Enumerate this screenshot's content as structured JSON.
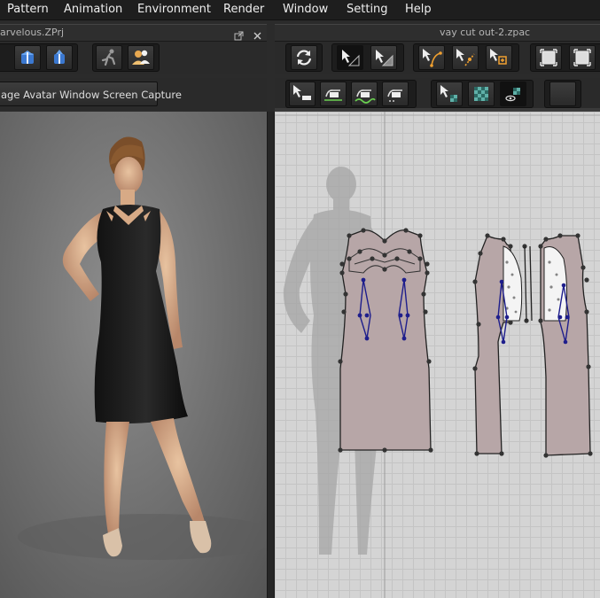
{
  "menu": {
    "items": [
      {
        "label": "Pattern"
      },
      {
        "label": "Animation"
      },
      {
        "label": "Environment"
      },
      {
        "label": "Render"
      },
      {
        "label": "Window"
      },
      {
        "label": "Setting"
      },
      {
        "label": "Help"
      }
    ]
  },
  "left_panel": {
    "title": "arvelous.ZPrj",
    "capture_button": "age Avatar Window Screen Capture"
  },
  "right_panel": {
    "title": "vay cut out-2.zpac"
  },
  "colors": {
    "pattern_fill": "#b7a6a7",
    "dart_line": "#1e1e8c",
    "accent_orange": "#f0a030"
  },
  "icons": {
    "left_toolbar": [
      "garment-view-icon",
      "garment-fold-icon",
      "running-avatar-icon",
      "avatar-users-icon"
    ],
    "right_toolbar": [
      "refresh-icon",
      "transform-pattern-icon",
      "edit-pattern-icon",
      "edit-curve-point-icon",
      "add-point-icon",
      "curve-point-icon",
      "pattern-select-icon",
      "pattern-box-icon"
    ],
    "right_toolbar_2": [
      "segment-tool-icon",
      "sewing-icon",
      "free-sewing-icon",
      "seam-tool-icon",
      "sewing-tool-icon",
      "texture-edit-icon",
      "texture-checker-icon",
      "texture-hide-icon",
      "blank-tool-icon"
    ]
  }
}
